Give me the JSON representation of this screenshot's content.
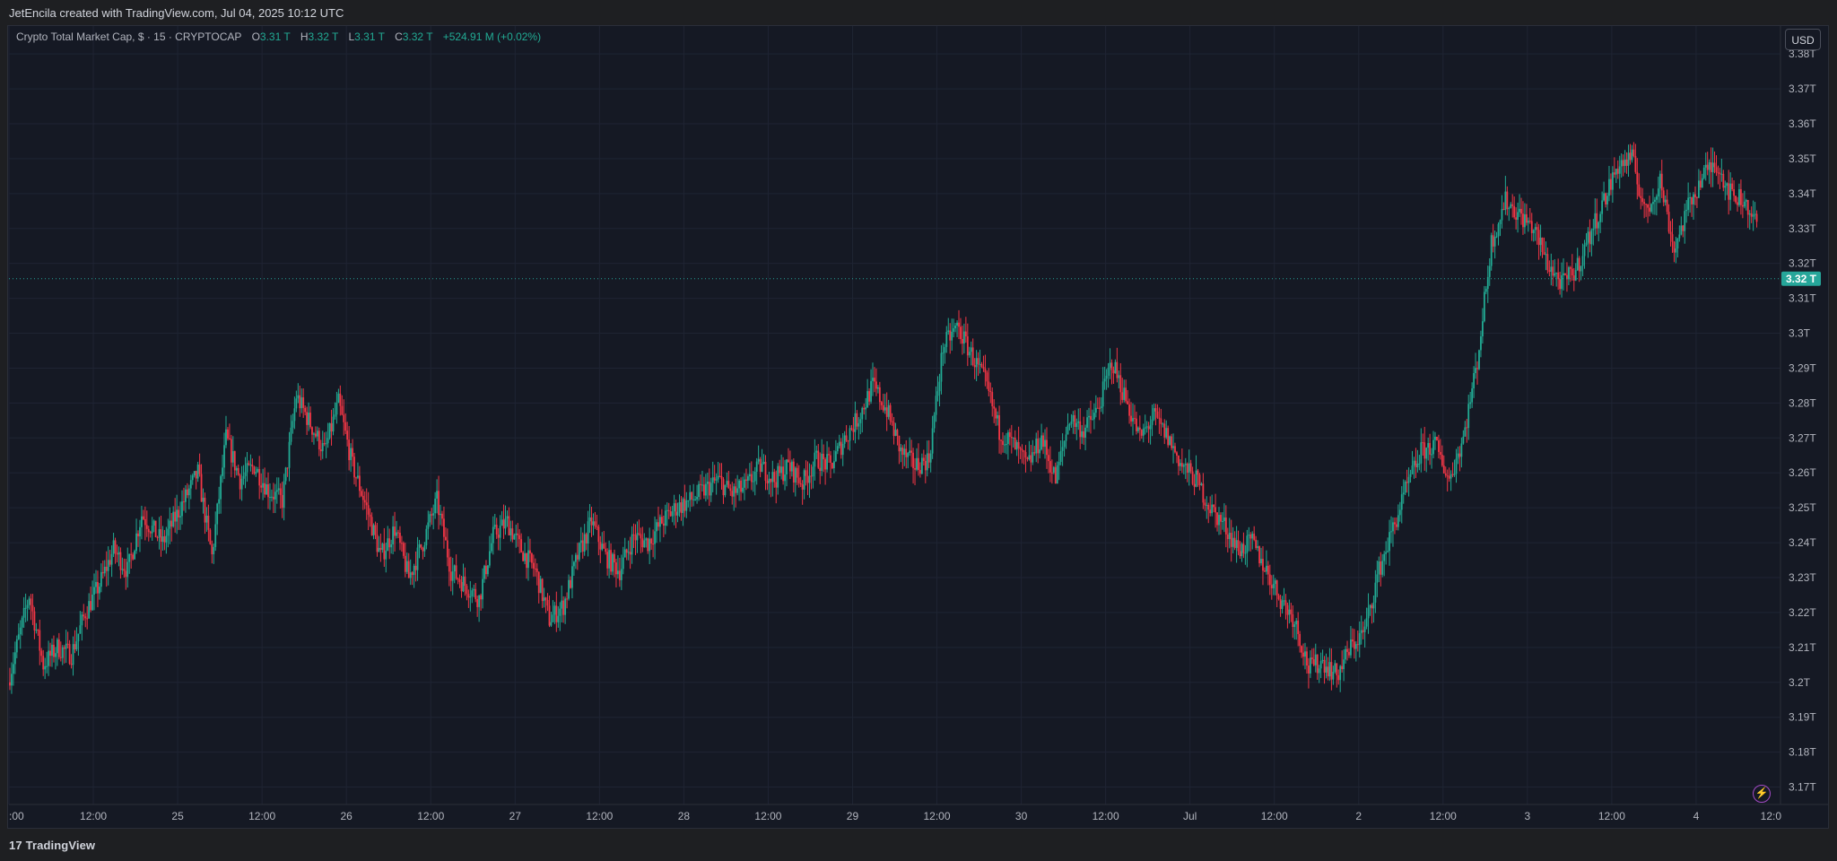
{
  "header": {
    "credit": "JetEncila created with TradingView.com, Jul 04, 2025 10:12 UTC"
  },
  "legend": {
    "symbol": "Crypto Total Market Cap, $ · 15 · CRYPTOCAP",
    "open_label": "O",
    "open_value": "3.31 T",
    "high_label": "H",
    "high_value": "3.32 T",
    "low_label": "L",
    "low_value": "3.31 T",
    "close_label": "C",
    "close_value": "3.32 T",
    "change": "+524.91 M (+0.02%)"
  },
  "currency_button": "USD",
  "last_price_label": "3.32 T",
  "footer": {
    "brand": "TradingView",
    "brand_mark": "17"
  },
  "colors": {
    "up": "#22ab94",
    "down": "#f23645",
    "background": "#151924",
    "grid": "#1f2433",
    "accent": "#26a69a"
  },
  "icons": {
    "alert": "lightning-bolt-icon"
  },
  "chart_data": {
    "type": "candlestick",
    "interval": "15",
    "y_unit": "T USD",
    "ylim": [
      3.165,
      3.388
    ],
    "y_ticks": [
      "3.38T",
      "3.37T",
      "3.36T",
      "3.35T",
      "3.34T",
      "3.33T",
      "3.32T",
      "3.31T",
      "3.3T",
      "3.29T",
      "3.28T",
      "3.27T",
      "3.26T",
      "3.25T",
      "3.24T",
      "3.23T",
      "3.22T",
      "3.21T",
      "3.2T",
      "3.19T",
      "3.18T",
      "3.17T"
    ],
    "y_tick_values": [
      3.38,
      3.37,
      3.36,
      3.35,
      3.34,
      3.33,
      3.32,
      3.31,
      3.3,
      3.29,
      3.28,
      3.27,
      3.26,
      3.25,
      3.24,
      3.23,
      3.22,
      3.21,
      3.2,
      3.19,
      3.18,
      3.17
    ],
    "x_ticks": [
      ":00",
      "12:00",
      "25",
      "12:00",
      "26",
      "12:00",
      "27",
      "12:00",
      "28",
      "12:00",
      "29",
      "12:00",
      "30",
      "12:00",
      "Jul",
      "12:00",
      "2",
      "12:00",
      "3",
      "12:00",
      "4",
      "12:0"
    ],
    "x_tick_hours": [
      0,
      12,
      24,
      36,
      48,
      60,
      72,
      84,
      96,
      108,
      120,
      132,
      144,
      156,
      168,
      180,
      192,
      204,
      216,
      228,
      240,
      252
    ],
    "x_range_hours": [
      0,
      252
    ],
    "last_price": 3.3156,
    "price_path_hours": [
      0,
      3,
      5,
      7,
      9,
      11,
      13,
      15,
      17,
      19,
      22,
      25,
      27,
      29,
      31,
      33,
      35,
      37,
      39,
      41,
      43,
      45,
      47,
      49,
      51,
      53,
      55,
      57,
      59,
      61,
      63,
      65,
      67,
      69,
      71,
      73,
      75,
      77,
      79,
      81,
      83,
      85,
      87,
      89,
      91,
      93,
      95,
      97,
      99,
      101,
      103,
      105,
      107,
      109,
      111,
      113,
      115,
      117,
      119,
      121,
      123,
      125,
      127,
      129,
      131,
      133,
      135,
      137,
      139,
      141,
      143,
      145,
      147,
      149,
      151,
      153,
      155,
      157,
      159,
      161,
      163,
      165,
      167,
      169,
      171,
      173,
      175,
      177,
      179,
      181,
      183,
      185,
      187,
      189,
      191,
      193,
      195,
      197,
      199,
      201,
      203,
      205,
      207,
      209,
      211,
      213,
      215,
      217,
      219,
      221,
      223,
      225,
      227,
      229,
      231,
      233,
      235,
      237,
      239,
      241,
      243,
      245,
      247,
      249,
      251
    ],
    "price_path_values": [
      3.2,
      3.225,
      3.205,
      3.21,
      3.208,
      3.22,
      3.228,
      3.238,
      3.232,
      3.248,
      3.24,
      3.252,
      3.26,
      3.236,
      3.27,
      3.258,
      3.262,
      3.255,
      3.252,
      3.282,
      3.274,
      3.266,
      3.28,
      3.262,
      3.25,
      3.236,
      3.244,
      3.23,
      3.24,
      3.252,
      3.232,
      3.228,
      3.224,
      3.242,
      3.246,
      3.238,
      3.232,
      3.218,
      3.222,
      3.236,
      3.246,
      3.236,
      3.232,
      3.242,
      3.24,
      3.246,
      3.25,
      3.252,
      3.255,
      3.258,
      3.254,
      3.256,
      3.262,
      3.258,
      3.262,
      3.257,
      3.264,
      3.262,
      3.27,
      3.276,
      3.285,
      3.278,
      3.266,
      3.262,
      3.264,
      3.296,
      3.302,
      3.294,
      3.286,
      3.272,
      3.268,
      3.262,
      3.27,
      3.258,
      3.276,
      3.272,
      3.278,
      3.292,
      3.281,
      3.27,
      3.276,
      3.27,
      3.262,
      3.258,
      3.25,
      3.245,
      3.238,
      3.24,
      3.232,
      3.224,
      3.218,
      3.204,
      3.206,
      3.202,
      3.21,
      3.215,
      3.232,
      3.244,
      3.256,
      3.266,
      3.268,
      3.258,
      3.27,
      3.292,
      3.326,
      3.338,
      3.334,
      3.33,
      3.32,
      3.314,
      3.318,
      3.328,
      3.338,
      3.348,
      3.35,
      3.334,
      3.344,
      3.324,
      3.336,
      3.345,
      3.349,
      3.34,
      3.338,
      3.33,
      3.32,
      3.314,
      3.298,
      3.312,
      3.316
    ]
  }
}
